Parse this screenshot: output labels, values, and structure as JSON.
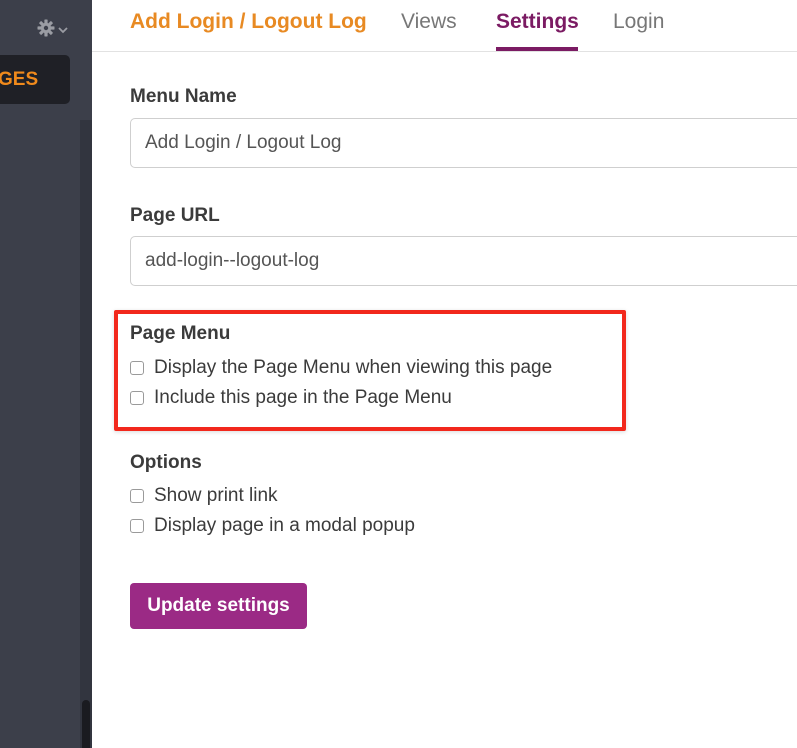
{
  "sidebar": {
    "pages_label": "GES",
    "settings_icon": "gear-icon",
    "dropdown_icon": "chevron-down-icon"
  },
  "nav": {
    "title": "Add Login / Logout Log",
    "tabs": [
      {
        "label": "Views",
        "active": false
      },
      {
        "label": "Settings",
        "active": true
      },
      {
        "label": "Login",
        "active": false
      }
    ]
  },
  "form": {
    "menu_name": {
      "label": "Menu Name",
      "value": "Add Login / Logout Log"
    },
    "page_url": {
      "label": "Page URL",
      "value": "add-login--logout-log"
    },
    "page_menu": {
      "label": "Page Menu",
      "options": [
        {
          "label": "Display the Page Menu when viewing this page",
          "checked": false
        },
        {
          "label": "Include this page in the Page Menu",
          "checked": false
        }
      ]
    },
    "options": {
      "label": "Options",
      "options": [
        {
          "label": "Show print link",
          "checked": false
        },
        {
          "label": "Display page in a modal popup",
          "checked": false
        }
      ]
    },
    "submit_label": "Update settings"
  },
  "colors": {
    "accent_orange": "#e88a23",
    "active_tab": "#7b1b63",
    "button": "#9b2a85",
    "highlight": "#f2281c",
    "sidebar_bg": "#3c3f4a"
  }
}
